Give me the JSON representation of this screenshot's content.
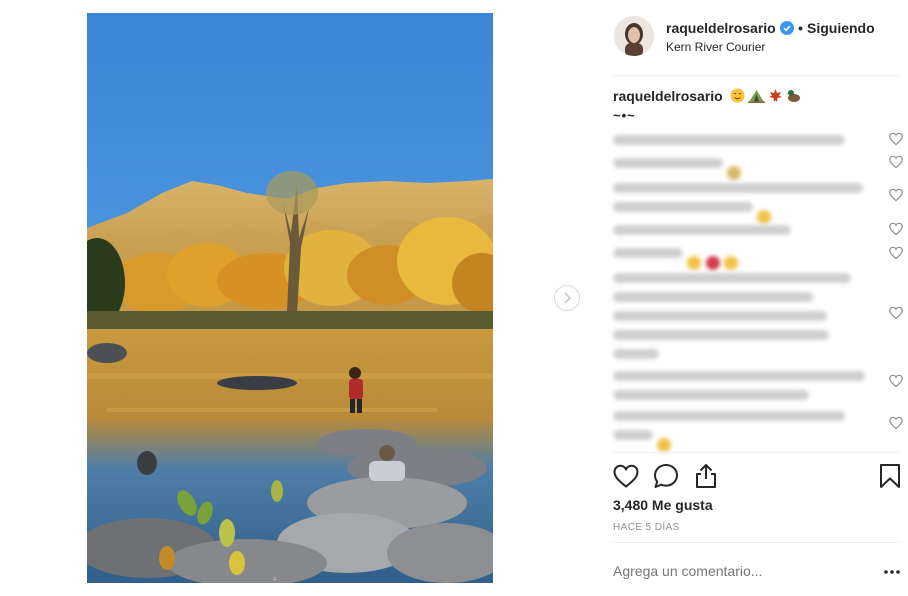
{
  "post": {
    "username": "raqueldelrosario",
    "verified": true,
    "dot": "•",
    "follow_status": "Siguiendo",
    "location": "Kern River Courier",
    "caption_user": "raqueldelrosario",
    "caption_emojis": [
      "smiling-face",
      "camping-tent",
      "maple-leaf",
      "duck"
    ],
    "caption_line2": "~•~",
    "likes": "3,480 Me gusta",
    "time_ago": "HACE 5 DÍAS",
    "comment_placeholder": "Agrega un comentario..."
  },
  "colors": {
    "text": "#262626",
    "muted": "#8e8e8e",
    "verified": "#3897f0",
    "divider": "#efefef",
    "sky": "#3f8fdc"
  },
  "icons": {
    "next": "chevron-right-icon",
    "like": "heart-icon",
    "comment": "comment-bubble-icon",
    "share": "share-icon",
    "save": "bookmark-icon",
    "more": "ellipsis-icon"
  }
}
